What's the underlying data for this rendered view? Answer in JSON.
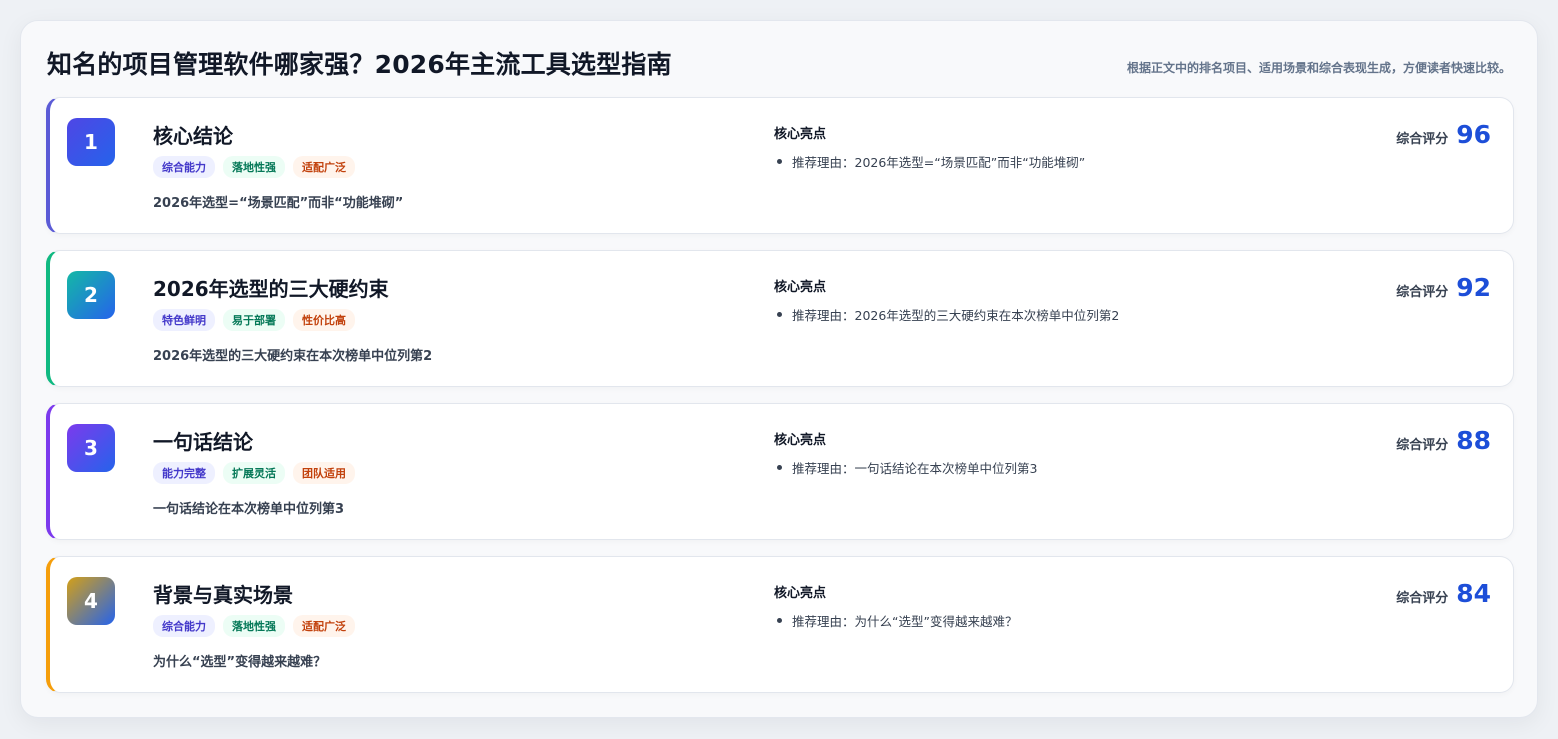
{
  "header": {
    "title": "知名的项目管理软件哪家强？2026年主流工具选型指南",
    "note": "根据正文中的排名项目、适用场景和综合表现生成，方便读者快速比较。"
  },
  "colors": {
    "card_accents": [
      "#5b5bd6",
      "#10b981",
      "#7c3aed",
      "#f59e0b"
    ],
    "rank_gradients": [
      [
        "#4f46e5",
        "#2563eb"
      ],
      [
        "#14b8a6",
        "#2563eb"
      ],
      [
        "#7c3aed",
        "#2563eb"
      ],
      [
        "#d4a017",
        "#2563eb"
      ]
    ],
    "score": "#1d4ed8"
  },
  "cards": [
    {
      "rank": "1",
      "title": "核心结论",
      "tags": [
        "综合能力",
        "落地性强",
        "适配广泛"
      ],
      "summary": "2026年选型=“场景匹配”而非“功能堆砌”",
      "highlight_label": "核心亮点",
      "highlight": "推荐理由：2026年选型=“场景匹配”而非“功能堆砌”",
      "score_label": "综合评分",
      "score": "96"
    },
    {
      "rank": "2",
      "title": "2026年选型的三大硬约束",
      "tags": [
        "特色鲜明",
        "易于部署",
        "性价比高"
      ],
      "summary": "2026年选型的三大硬约束在本次榜单中位列第2",
      "highlight_label": "核心亮点",
      "highlight": "推荐理由：2026年选型的三大硬约束在本次榜单中位列第2",
      "score_label": "综合评分",
      "score": "92"
    },
    {
      "rank": "3",
      "title": "一句话结论",
      "tags": [
        "能力完整",
        "扩展灵活",
        "团队适用"
      ],
      "summary": "一句话结论在本次榜单中位列第3",
      "highlight_label": "核心亮点",
      "highlight": "推荐理由：一句话结论在本次榜单中位列第3",
      "score_label": "综合评分",
      "score": "88"
    },
    {
      "rank": "4",
      "title": "背景与真实场景",
      "tags": [
        "综合能力",
        "落地性强",
        "适配广泛"
      ],
      "summary": "为什么“选型”变得越来越难？",
      "highlight_label": "核心亮点",
      "highlight": "推荐理由：为什么“选型”变得越来越难？",
      "score_label": "综合评分",
      "score": "84"
    }
  ]
}
